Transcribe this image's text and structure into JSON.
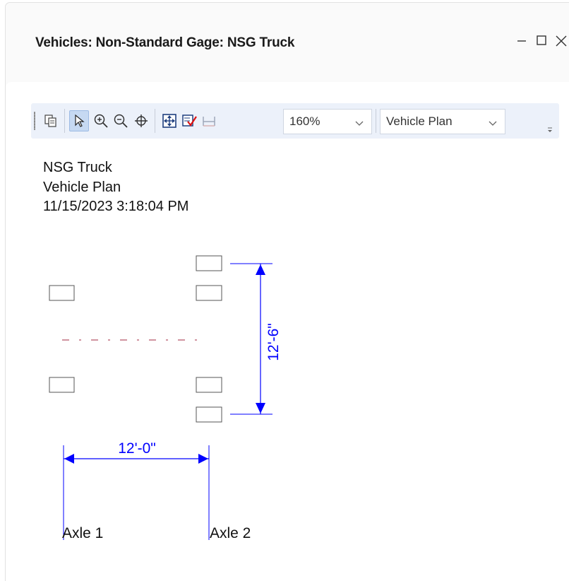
{
  "window": {
    "title": "Vehicles: Non-Standard Gage: NSG Truck",
    "controls": [
      "minimize-icon",
      "maximize-icon",
      "close-icon"
    ]
  },
  "toolbar": {
    "buttons": [
      "copy-icon",
      "select-pointer-icon",
      "zoom-in-icon",
      "zoom-out-icon",
      "pan-icon",
      "zoom-extents-icon",
      "properties-check-icon",
      "dimensions-icon"
    ],
    "zoom": {
      "value": "160%"
    },
    "view": {
      "value": "Vehicle Plan"
    }
  },
  "report": {
    "name": "NSG Truck",
    "view": "Vehicle Plan",
    "timestamp": "11/15/2023 3:18:04 PM"
  },
  "drawing": {
    "gage_dimension": "12'-6\"",
    "axle_spacing": "12'-0\"",
    "axles": [
      "Axle 1",
      "Axle 2"
    ],
    "dimension_color": "#0000ff",
    "centerline_color": "#c07080"
  }
}
